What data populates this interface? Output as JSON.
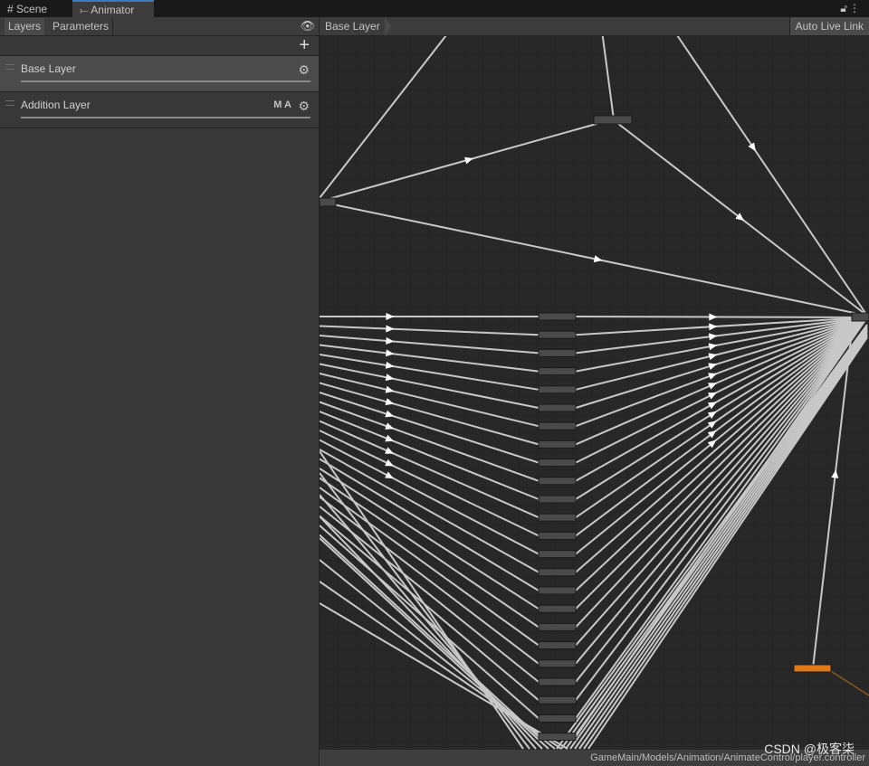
{
  "tabs": [
    {
      "label": "Scene",
      "icon": "grid-icon"
    },
    {
      "label": "Animator",
      "icon": "animator-icon"
    }
  ],
  "left_panel": {
    "tabs": [
      "Layers",
      "Parameters"
    ],
    "layers": [
      {
        "name": "Base Layer"
      },
      {
        "name": "Addition Layer",
        "badges": "M A"
      }
    ]
  },
  "graph": {
    "breadcrumb": "Base Layer",
    "auto_live_link": "Auto Live Link",
    "path": "GameMain/Models/Animation/AnimateControl/player.controller",
    "state_count": 24,
    "accent_state_color": "#e07a1a"
  },
  "watermark": "CSDN @极客柒"
}
